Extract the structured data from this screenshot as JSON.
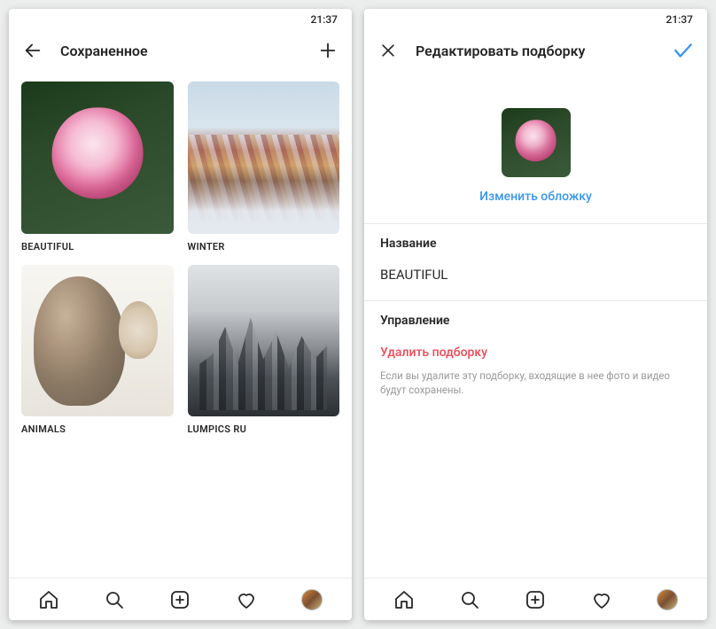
{
  "left": {
    "time": "21:37",
    "title": "Сохраненное",
    "collections": [
      {
        "label": "BEAUTIFUL"
      },
      {
        "label": "WINTER"
      },
      {
        "label": "ANIMALS"
      },
      {
        "label": "LUMPICS RU"
      }
    ]
  },
  "right": {
    "time": "21:37",
    "title": "Редактировать подборку",
    "change_cover": "Изменить обложку",
    "name_label": "Название",
    "name_value": "BEAUTIFUL",
    "manage_label": "Управление",
    "delete_action": "Удалить подборку",
    "hint": "Если вы удалите эту подборку, входящие в нее фото и видео будут сохранены."
  }
}
